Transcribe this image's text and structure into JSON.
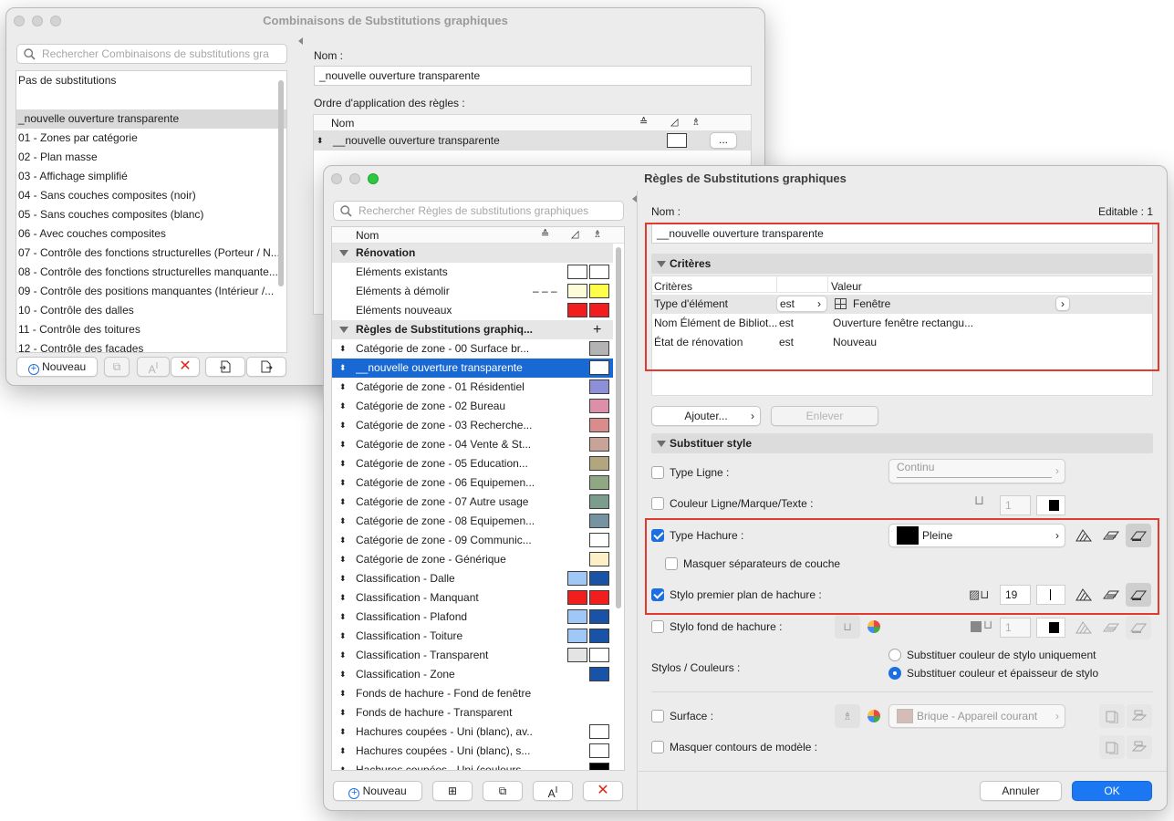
{
  "combo_window": {
    "title": "Combinaisons de Substitutions graphiques",
    "search_placeholder": "Rechercher Combinaisons de substitutions gra",
    "items": [
      "Pas de substitutions",
      "_nouvelle ouverture transparente",
      "01 - Zones par catégorie",
      "02 - Plan masse",
      "03 - Affichage simplifié",
      "04 - Sans couches composites (noir)",
      "05 - Sans couches composites (blanc)",
      "06 - Avec couches composites",
      "07 - Contrôle des fonctions structurelles (Porteur / N...",
      "08 - Contrôle des fonctions structurelles manquante...",
      "09 - Contrôle des positions manquantes (Intérieur /...",
      "10 - Contrôle des dalles",
      "11 - Contrôle des toitures",
      "12 - Contrôle des façades"
    ],
    "new_button": "Nouveau",
    "name_label": "Nom :",
    "name_value": "_nouvelle ouverture transparente",
    "order_label": "Ordre d'application des règles :",
    "order_col_name": "Nom",
    "order_rows": [
      "__nouvelle ouverture transparente"
    ],
    "more_button": "..."
  },
  "rules_window": {
    "title": "Règles de Substitutions graphiques",
    "search_placeholder": "Rechercher Règles de substitutions graphiques",
    "col_name": "Nom",
    "groups": [
      {
        "title": "Rénovation",
        "rows": [
          {
            "label": "Eléments existants",
            "sw1": "#ffffff",
            "sw2": "#ffffff"
          },
          {
            "label": "Eléments à démolir",
            "dash": "– – –",
            "sw1": "#fdfbd8",
            "sw2": "#fefe4a"
          },
          {
            "label": "Eléments nouveaux",
            "sw1": "#f21d1d",
            "sw2": "#f21d1d"
          }
        ]
      },
      {
        "title": "Règles de Substitutions graphiq...",
        "rows": [
          {
            "label": "Catégorie de zone - 00 Surface br...",
            "sw2": "#b3b3b3"
          },
          {
            "label": "__nouvelle ouverture transparente",
            "sw2": "#ffffff",
            "selected": true
          },
          {
            "label": "Catégorie de zone - 01 Résidentiel",
            "sw2": "#8d8fd8"
          },
          {
            "label": "Catégorie de zone - 02 Bureau",
            "sw2": "#dc8fa8"
          },
          {
            "label": "Catégorie de zone - 03 Recherche...",
            "sw2": "#d88c8c"
          },
          {
            "label": "Catégorie de zone - 04 Vente & St...",
            "sw2": "#c7a497"
          },
          {
            "label": "Catégorie de zone - 05 Education...",
            "sw2": "#b3a67e"
          },
          {
            "label": "Catégorie de zone - 06 Equipemen...",
            "sw2": "#8fa883"
          },
          {
            "label": "Catégorie de zone - 07 Autre usage",
            "sw2": "#7a9d8d"
          },
          {
            "label": "Catégorie de zone - 08 Equipemen...",
            "sw2": "#7593a1"
          },
          {
            "label": "Catégorie de zone - 09 Communic...",
            "sw2": "#ffffff"
          },
          {
            "label": "Catégorie de zone - Générique",
            "sw2": "#fdf0c8"
          },
          {
            "label": "Classification - Dalle",
            "sw1": "#9fc8f7",
            "sw2": "#1853a8"
          },
          {
            "label": "Classification - Manquant",
            "sw1": "#f21d1d",
            "sw2": "#f21d1d"
          },
          {
            "label": "Classification - Plafond",
            "sw1": "#9fc8f7",
            "sw2": "#1853a8"
          },
          {
            "label": "Classification - Toiture",
            "sw1": "#9fc8f7",
            "sw2": "#1853a8"
          },
          {
            "label": "Classification - Transparent",
            "sw1": "#e4e4e4",
            "sw2": "#ffffff"
          },
          {
            "label": "Classification - Zone",
            "sw2": "#1853a8"
          },
          {
            "label": "Fonds de hachure  - Fond de fenêtre"
          },
          {
            "label": "Fonds de hachure  - Transparent"
          },
          {
            "label": "Hachures coupées - Uni (blanc), av...",
            "sw2": "#ffffff"
          },
          {
            "label": "Hachures coupées - Uni (blanc), s...",
            "sw2": "#ffffff"
          },
          {
            "label": "Hachures coupées - Uni (couleurs...",
            "sw2": "#000000"
          }
        ]
      }
    ],
    "new_button": "Nouveau",
    "name_label": "Nom :",
    "editable_label": "Editable : 1",
    "name_value": "__nouvelle ouverture transparente",
    "criteria_section": "Critères",
    "criteria_headers": [
      "Critères",
      "Valeur"
    ],
    "criteria": [
      {
        "crit": "Type d'élément",
        "op": "est",
        "value": "Fenêtre"
      },
      {
        "crit": "Nom Élément de Bibliot...",
        "op": "est",
        "value": "Ouverture fenêtre rectangu..."
      },
      {
        "crit": "État de rénovation",
        "op": "est",
        "value": "Nouveau"
      }
    ],
    "add_button": "Ajouter...",
    "remove_button": "Enlever",
    "style_section": "Substituer style",
    "line_type_label": "Type Ligne :",
    "line_type_value": "Continu",
    "line_color_label": "Couleur Ligne/Marque/Texte :",
    "line_pen_value": "1",
    "fill_type_label": "Type Hachure :",
    "fill_type_value": "Pleine",
    "hide_separators_label": "Masquer séparateurs de couche",
    "fg_pen_label": "Stylo premier plan de hachure :",
    "fg_pen_value": "19",
    "bg_pen_label": "Stylo fond de hachure :",
    "bg_pen_value": "1",
    "pens_label": "Stylos / Couleurs :",
    "radio1": "Substituer couleur de stylo uniquement",
    "radio2": "Substituer couleur et épaisseur de stylo",
    "surface_label": "Surface :",
    "surface_value": "Brique - Appareil courant",
    "hide_contours_label": "Masquer contours de modèle :",
    "cancel_button": "Annuler",
    "ok_button": "OK"
  }
}
